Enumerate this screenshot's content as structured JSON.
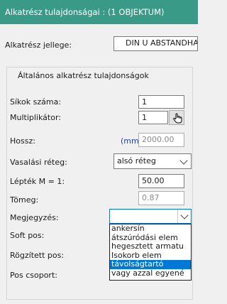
{
  "window": {
    "title": "Alkatrész tulajdonságai : (1 OBJEKTUM)"
  },
  "type_row": {
    "label": "Alkatrész jellege:",
    "value": "DIN U ABSTANDHA"
  },
  "general_group": {
    "title": "Általános alkatrész tulajdonságok",
    "fields": {
      "planes": {
        "label": "Síkok száma:",
        "value": "1"
      },
      "multiplier": {
        "label": "Multiplikátor:",
        "value": "1"
      },
      "length": {
        "label": "Hossz:",
        "unit": "(mm):",
        "value": "2000.00"
      },
      "rebar_layer": {
        "label": "Vasalási réteg:",
        "value": "alsó réteg"
      },
      "scale": {
        "label": "Lépték M = 1:",
        "value": "50.00"
      },
      "weight": {
        "label": "Tömeg:",
        "value": "0.87"
      },
      "note": {
        "label": "Megjegyzés:",
        "value": ""
      },
      "soft_pos": {
        "label": "Soft pos:"
      },
      "fixed_pos": {
        "label": "Rögzített pos:"
      },
      "pos_group": {
        "label": "Pos csoport:"
      }
    }
  },
  "note_dropdown": {
    "options": [
      "ankersín",
      "átszúródási elem",
      "hegesztett armatu",
      "Isokorb elem",
      "távolságtartó",
      "vagy azzal egyené"
    ],
    "selected_index": 4
  },
  "icons": {
    "hand": "hand-pointer-icon",
    "chevron": "chevron-down-icon"
  },
  "colors": {
    "titlebar": "#3a9a88",
    "selection": "#0078d7",
    "unit_text": "#1f3fbf"
  }
}
